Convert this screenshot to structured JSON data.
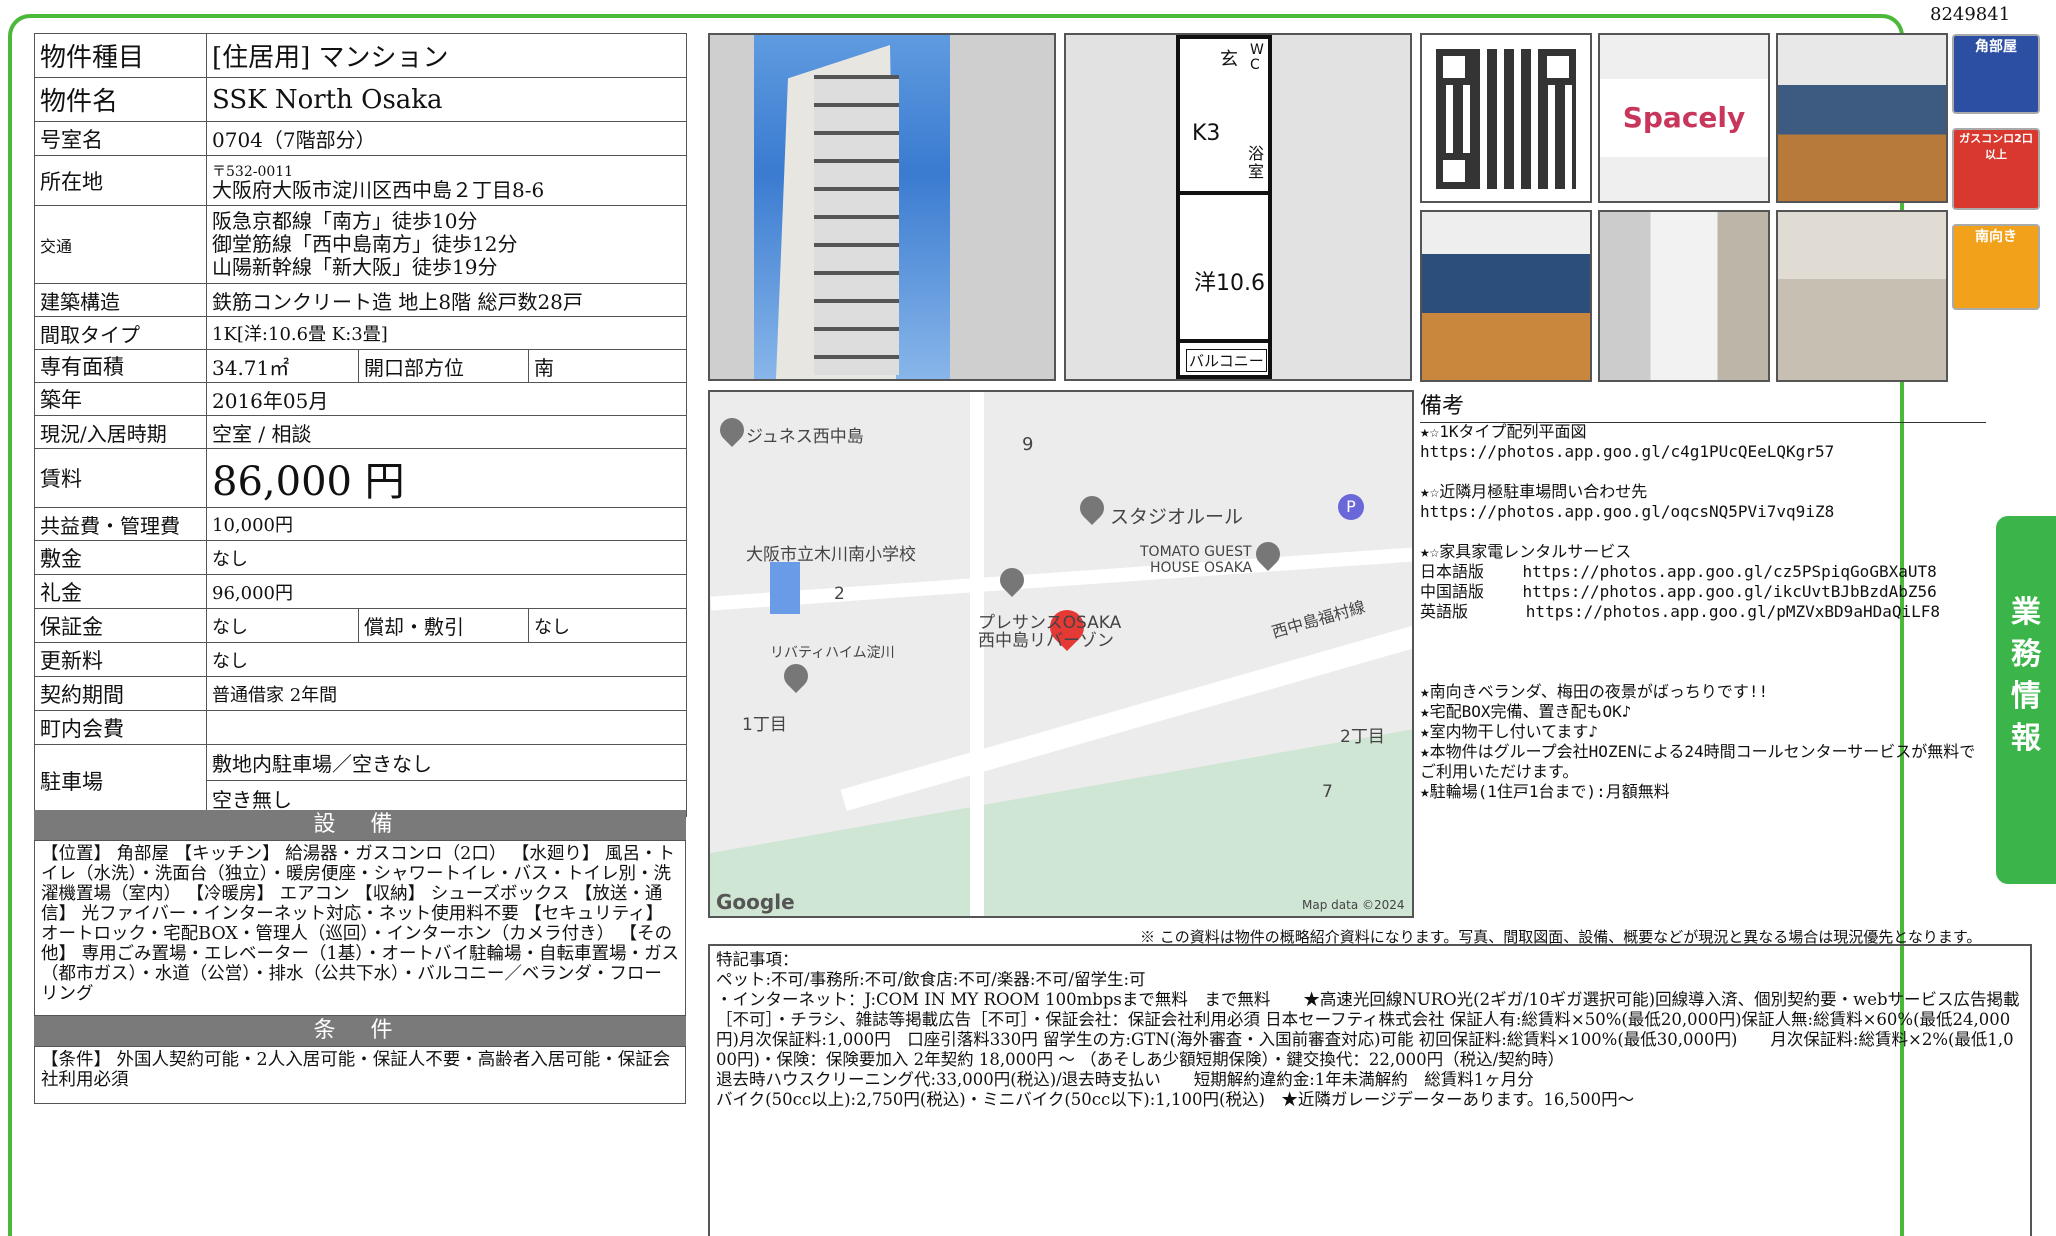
{
  "property_id": "8249841",
  "specs": {
    "type_label": "物件種目",
    "type_value": "[住居用] マンション",
    "name_label": "物件名",
    "name_value": "SSK North Osaka",
    "room_label": "号室名",
    "room_value": "0704（7階部分）",
    "address_label": "所在地",
    "postal": "〒532-0011",
    "address": "大阪府大阪市淀川区西中島２丁目8-6",
    "access_label": "交通",
    "access": [
      "阪急京都線「南方」徒歩10分",
      "御堂筋線「西中島南方」徒歩12分",
      "山陽新幹線「新大阪」徒歩19分"
    ],
    "structure_label": "建築構造",
    "structure_value": "鉄筋コンクリート造 地上8階 総戸数28戸",
    "layout_label": "間取タイプ",
    "layout_value": "1K[洋:10.6畳 K:3畳]",
    "area_label": "専有面積",
    "area_value": "34.71㎡",
    "facing_label": "開口部方位",
    "facing_value": "南",
    "built_label": "築年",
    "built_value": "2016年05月",
    "status_label": "現況/入居時期",
    "status_value": "空室 / 相談",
    "rent_label": "賃料",
    "rent_value": "86,000 円",
    "fee_label": "共益費・管理費",
    "fee_value": "10,000円",
    "deposit_label": "敷金",
    "deposit_value": "なし",
    "keymoney_label": "礼金",
    "keymoney_value": "96,000円",
    "guarantee_label": "保証金",
    "guarantee_value": "なし",
    "amort_label": "償却・敷引",
    "amort_value": "なし",
    "renewal_label": "更新料",
    "renewal_value": "なし",
    "contract_label": "契約期間",
    "contract_value": "普通借家 2年間",
    "neighborhood_label": "町内会費",
    "neighborhood_value": "",
    "parking_label": "駐車場",
    "parking_value1": "敷地内駐車場／空きなし",
    "parking_value2": "空き無し"
  },
  "facilities": {
    "heading": "設 備",
    "text": "【位置】 角部屋 【キッチン】 給湯器・ガスコンロ（2口） 【水廻り】 風呂・トイレ（水洗）・洗面台（独立）・暖房便座・シャワートイレ・バス・トイレ別・洗濯機置場（室内） 【冷暖房】 エアコン 【収納】 シューズボックス 【放送・通信】 光ファイバー・インターネット対応・ネット使用料不要 【セキュリティ】 オートロック・宅配BOX・管理人（巡回）・インターホン（カメラ付き） 【その他】 専用ごみ置場・エレベーター（1基）・オートバイ駐輪場・自転車置場・ガス（都市ガス）・水道（公営）・排水（公共下水）・バルコニー／ベランダ・フローリング"
  },
  "conditions": {
    "heading": "条 件",
    "text": "【条件】 外国人契約可能・2人入居可能・保証人不要・高齢者入居可能・保証会社利用必須"
  },
  "floorplan": {
    "genkan": "玄",
    "wc": "W C",
    "kitchen": "K3",
    "bath": "浴 室",
    "western": "洋10.6",
    "balcony": "バルコニー"
  },
  "spacely": "Spacely",
  "badges": {
    "corner": "角部屋",
    "gas": "ガスコンロ2口以上",
    "south": "南向き"
  },
  "map": {
    "labels": [
      "ジュネス西中島",
      "9",
      "スタジオルール",
      "大阪市立木川南小学校",
      "TOMATO GUEST",
      "HOUSE OSAKA",
      "2",
      "プレサンスOSAKA",
      "西中島リバーゾン",
      "西中島福村線",
      "リバティハイム淀川",
      "1丁目",
      "2丁目",
      "7"
    ],
    "google": "Google",
    "attribution": "Map data ©2024"
  },
  "remarks": {
    "heading": "備考",
    "text": "★☆1Kタイプ配列平面図\nhttps://photos.app.goo.gl/c4g1PUcQEeLQKgr57\n\n★☆近隣月極駐車場問い合わせ先\nhttps://photos.app.goo.gl/oqcsNQ5PVi7vq9iZ8\n\n★☆家具家電レンタルサービス\n日本語版    https://photos.app.goo.gl/cz5PSpiqGoGBXaUT8\n中国語版    https://photos.app.goo.gl/ikcUvtBJbBzdAbZ56\n英語版      https://photos.app.goo.gl/pMZVxBD9aHDaQiLF8\n\n\n\n★南向きベランダ、梅田の夜景がばっちりです!!\n★宅配BOX完備、置き配もOK♪\n★室内物干し付いてます♪\n★本物件はグループ会社HOZENによる24時間コールセンターサービスが無料でご利用いただけます。\n★駐輪場(1住戸1台まで):月額無料"
  },
  "note": "※ この資料は物件の概略紹介資料になります。写真、間取図面、設備、概要などが現況と異なる場合は現況優先となります。",
  "special": {
    "text": "特記事項：\nペット:不可/事務所:不可/飲食店:不可/楽器:不可/留学生:可\n・インターネット：J:COM IN MY ROOM 100mbpsまで無料　まで無料　　★高速光回線NURO光(2ギガ/10ギガ選択可能)回線導入済、個別契約要・webサービス広告掲載［不可］・チラシ、雑誌等掲載広告［不可］・保証会社：保証会社利用必須 日本セーフティ株式会社 保証人有:総賃料×50%(最低20,000円)保証人無:総賃料×60%(最低24,000円)月次保証料:1,000円　口座引落料330円 留学生の方:GTN(海外審査・入国前審査対応)可能 初回保証料:総賃料×100%(最低30,000円)　　月次保証料:総賃料×2%(最低1,000円)・保険：保険要加入 2年契約 18,000円 ～ （あそしあ少額短期保険）・鍵交換代：22,000円（税込/契約時）\n退去時ハウスクリーニング代:33,000円(税込)/退去時支払い　　短期解約違約金:1年未満解約　総賃料1ヶ月分\nバイク(50cc以上):2,750円(税込)・ミニバイク(50cc以下):1,100円(税込)　★近隣ガレージデーターあります。16,500円～"
  },
  "sidebar": "業務情報",
  "colors": {
    "frame": "#4cb83a",
    "header": "#7a7a7a",
    "pin": "#e53935"
  }
}
